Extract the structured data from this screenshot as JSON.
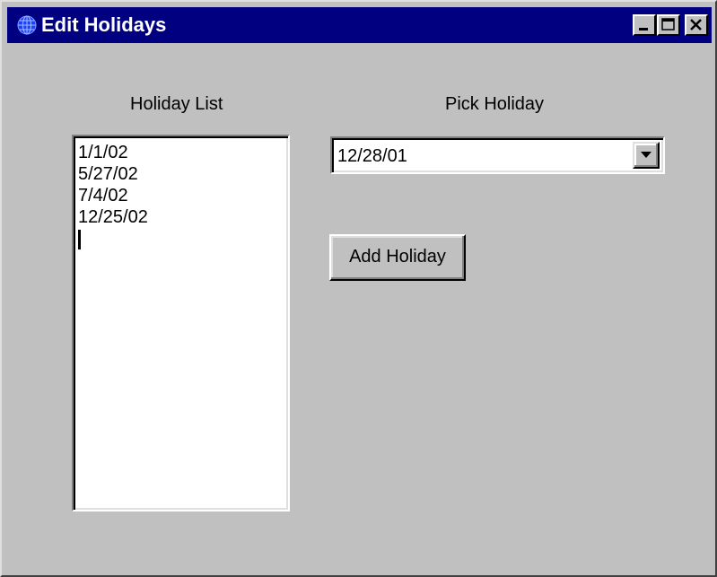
{
  "window": {
    "title": "Edit Holidays",
    "title_bar_color": "#000080",
    "icon": "globe-icon"
  },
  "title_buttons": {
    "minimize_icon": "minimize-icon",
    "maximize_icon": "maximize-icon",
    "close_icon": "close-icon"
  },
  "holiday_list": {
    "label": "Holiday List",
    "items": [
      "1/1/02",
      "5/27/02",
      "7/4/02",
      "12/25/02"
    ]
  },
  "pick_holiday": {
    "label": "Pick Holiday",
    "selected_value": "12/28/01",
    "arrow_icon": "chevron-down-icon"
  },
  "add_button": {
    "label": "Add Holiday"
  },
  "colors": {
    "face": "#c0c0c0",
    "field": "#ffffff",
    "title_bar": "#000080"
  }
}
